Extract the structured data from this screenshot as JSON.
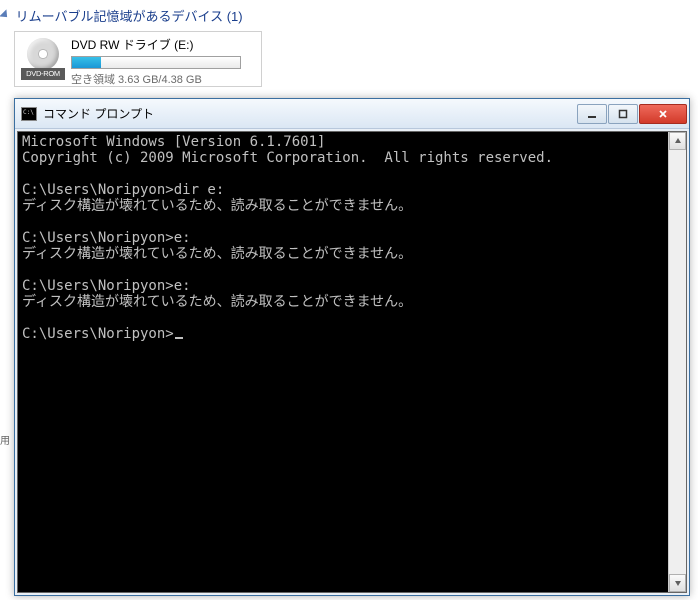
{
  "explorer": {
    "section_title": "リムーバブル記憶域があるデバイス (1)",
    "drive": {
      "icon_label": "DVD-ROM",
      "name": "DVD RW ドライブ (E:)",
      "free_text": "空き領域 3.63 GB/4.38 GB"
    }
  },
  "cmd": {
    "title": "コマンド プロンプト",
    "lines": [
      "Microsoft Windows [Version 6.1.7601]",
      "Copyright (c) 2009 Microsoft Corporation.  All rights reserved.",
      "",
      "C:\\Users\\Noripyon>dir e:",
      "ディスク構造が壊れているため、読み取ることができません。",
      "",
      "C:\\Users\\Noripyon>e:",
      "ディスク構造が壊れているため、読み取ることができません。",
      "",
      "C:\\Users\\Noripyon>e:",
      "ディスク構造が壊れているため、読み取ることができません。",
      "",
      "C:\\Users\\Noripyon>"
    ]
  },
  "sidebar_tab": "用"
}
